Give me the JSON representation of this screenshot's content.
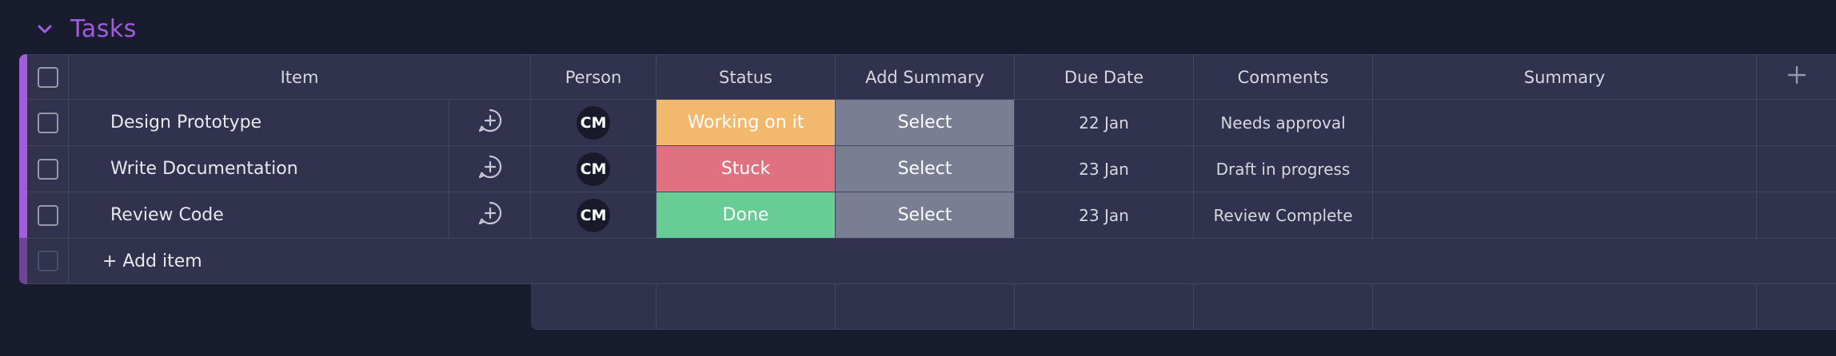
{
  "group": {
    "title": "Tasks",
    "color": "#a25ddc",
    "toggle_icon": "chevron-down-icon"
  },
  "columns": {
    "item": "Item",
    "person": "Person",
    "status": "Status",
    "add_summary": "Add Summary",
    "due_date": "Due Date",
    "comments": "Comments",
    "summary": "Summary",
    "add_column_icon": "plus-icon"
  },
  "rows": [
    {
      "name": "Design Prototype",
      "person": "CM",
      "status": "Working on it",
      "status_color": "#f2b96e",
      "add_summary": "Select",
      "due_date": "22 Jan",
      "comments": "Needs approval",
      "summary": ""
    },
    {
      "name": "Write Documentation",
      "person": "CM",
      "status": "Stuck",
      "status_color": "#e07180",
      "add_summary": "Select",
      "due_date": "23 Jan",
      "comments": "Draft in progress",
      "summary": ""
    },
    {
      "name": "Review Code",
      "person": "CM",
      "status": "Done",
      "status_color": "#67cd95",
      "add_summary": "Select",
      "due_date": "23 Jan",
      "comments": "Review Complete",
      "summary": ""
    }
  ],
  "add_item_label": "+ Add item"
}
